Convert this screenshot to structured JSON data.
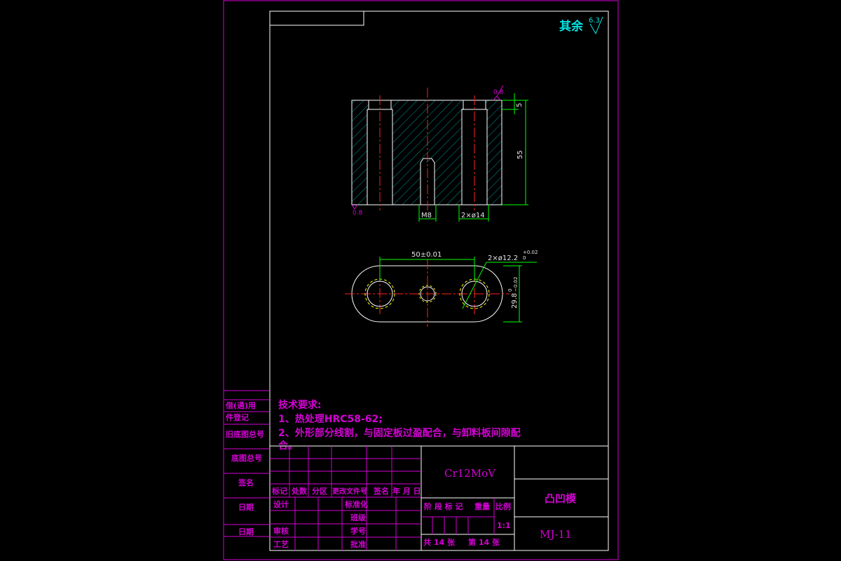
{
  "surface_finish": {
    "label": "其余",
    "value": "6.3"
  },
  "front_view": {
    "roughness_top": "0.8",
    "roughness_bottom": "0.8",
    "dim_height_small": "5",
    "dim_height_total": "55",
    "dim_thread": "M8",
    "dim_holes": "2×ø14"
  },
  "top_view": {
    "dim_center_distance": "50±0.01",
    "dim_hole_dia": "2×ø12.2",
    "dim_hole_tol_upper": "+0.02",
    "dim_hole_tol_lower": "0",
    "dim_width": "29.8",
    "dim_width_tol_upper": "0",
    "dim_width_tol_lower": "−0.02"
  },
  "tech_requirements": {
    "title": "技术要求:",
    "items": [
      "1、热处理HRC58-62;",
      "2、外形部分线割，与固定板过盈配合，与卸料板间隙配",
      "合。"
    ]
  },
  "side_table": [
    "借(通)用",
    "件登记",
    "旧底图总号",
    "底图总号",
    "签名",
    "日期",
    "日期"
  ],
  "title_block": {
    "material": "Cr12MoV",
    "part_name": "凸凹模",
    "drawing_no": "MJ-11",
    "rev_header": [
      "标记",
      "处数",
      "分区",
      "更改文件号",
      "签名",
      "年 月 日"
    ],
    "roles_left": [
      "设计",
      "审核",
      "工艺"
    ],
    "roles_right": [
      "标准化",
      "班级",
      "学号",
      "批准"
    ],
    "stage_header": [
      "阶 段 标 记",
      "重量",
      "比例"
    ],
    "scale": "1:1",
    "sheets_total": "共 14 张",
    "sheet_no": "第 14 张"
  }
}
